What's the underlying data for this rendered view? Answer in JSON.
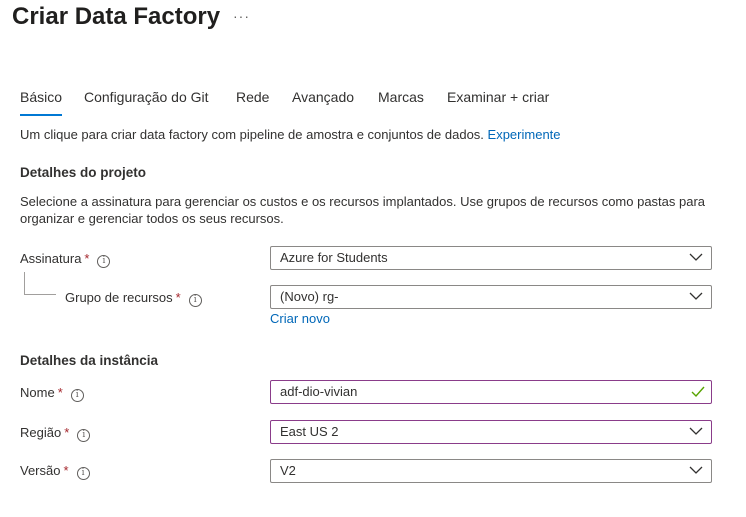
{
  "header": {
    "title": "Criar Data Factory",
    "more_label": "···"
  },
  "tabs": [
    {
      "label": "Básico",
      "active": true
    },
    {
      "label": "Configuração do Git"
    },
    {
      "label": "Rede"
    },
    {
      "label": "Avançado"
    },
    {
      "label": "Marcas"
    },
    {
      "label": "Examinar + criar"
    }
  ],
  "intro": {
    "text": "Um clique para criar data factory com pipeline de amostra e conjuntos de dados. ",
    "link": "Experimente"
  },
  "project": {
    "title": "Detalhes do projeto",
    "description": "Selecione a assinatura para gerenciar os custos e os recursos implantados. Use grupos de recursos como pastas para organizar e gerenciar todos os seus recursos.",
    "subscription": {
      "label": "Assinatura",
      "required": "*",
      "value": "Azure for Students"
    },
    "resource_group": {
      "label": "Grupo de recursos",
      "required": "*",
      "value": "(Novo) rg-",
      "create_new": "Criar novo"
    }
  },
  "instance": {
    "title": "Detalhes da instância",
    "name": {
      "label": "Nome",
      "required": "*",
      "value": "adf-dio-vivian"
    },
    "region": {
      "label": "Região",
      "required": "*",
      "value": "East US 2"
    },
    "version": {
      "label": "Versão",
      "required": "*",
      "value": "V2"
    }
  },
  "icons": {
    "info": "info-icon",
    "dropdown": "chevron-down-icon",
    "valid": "checkmark-icon"
  },
  "colors": {
    "accent": "#0078d4",
    "link": "#0067b8",
    "required": "#a4262c",
    "focus_border": "#8a3c8a",
    "valid_check": "#57a300"
  }
}
